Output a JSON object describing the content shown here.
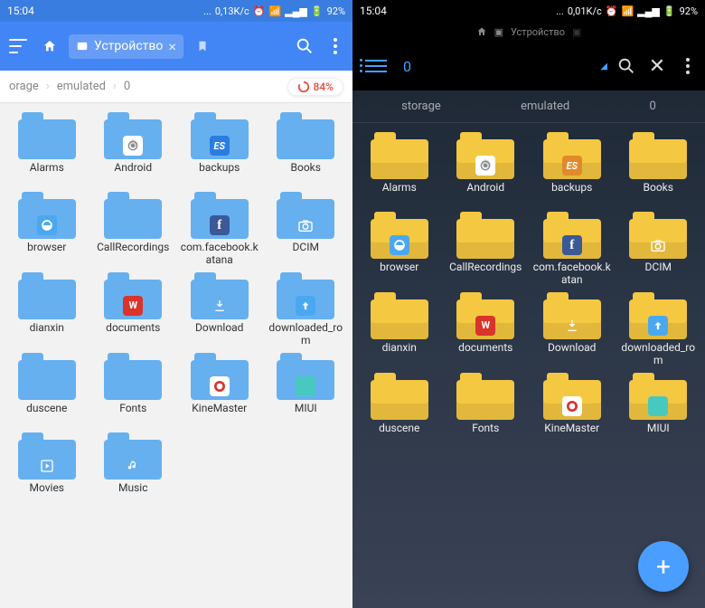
{
  "left": {
    "status": {
      "time": "15:04",
      "net_speed": "0,13K/c",
      "battery": "92%"
    },
    "toolbar": {
      "tab_label": "Устройство"
    },
    "breadcrumb": {
      "p1": "orage",
      "p2": "emulated",
      "p3": "0",
      "storage_pct": "84%"
    },
    "folders": [
      {
        "name": "Alarms"
      },
      {
        "name": "Android",
        "badge": "gear",
        "color": "#fff"
      },
      {
        "name": "backups",
        "badge": "es",
        "color": "#2a7de0"
      },
      {
        "name": "Books"
      },
      {
        "name": "browser",
        "badge": "leaf",
        "color": "#4aa8f0"
      },
      {
        "name": "CallRecordings"
      },
      {
        "name": "com.facebook.katana",
        "badge": "fb",
        "color": "#3b5998"
      },
      {
        "name": "DCIM",
        "badge": "cam",
        "color": "transparent"
      },
      {
        "name": "dianxin"
      },
      {
        "name": "documents",
        "badge": "wps",
        "color": "#d9332b"
      },
      {
        "name": "Download",
        "badge": "dl",
        "color": "transparent"
      },
      {
        "name": "downloaded_rom",
        "badge": "up",
        "color": "#4aa8f0"
      },
      {
        "name": "duscene"
      },
      {
        "name": "Fonts"
      },
      {
        "name": "KineMaster",
        "badge": "km",
        "color": "#fff"
      },
      {
        "name": "MIUI",
        "badge": "miui",
        "color": "#48c9c0"
      },
      {
        "name": "Movies",
        "badge": "play",
        "color": "transparent"
      },
      {
        "name": "Music",
        "badge": "music",
        "color": "transparent"
      },
      {
        "name": "",
        "hidden": true
      },
      {
        "name": "",
        "hidden": true
      }
    ]
  },
  "right": {
    "status": {
      "time": "15:04",
      "net_speed": "0,01K/c",
      "battery": "92%"
    },
    "mini_header": "Устройство",
    "toolbar": {
      "count": "0"
    },
    "breadcrumb": {
      "p1": "storage",
      "p2": "emulated",
      "p3": "0"
    },
    "folders": [
      {
        "name": "Alarms"
      },
      {
        "name": "Android",
        "badge": "gear",
        "color": "#fff"
      },
      {
        "name": "backups",
        "badge": "es",
        "color": "#e08a2a"
      },
      {
        "name": "Books"
      },
      {
        "name": "browser",
        "badge": "leaf",
        "color": "#4aa8f0"
      },
      {
        "name": "CallRecordings"
      },
      {
        "name": "com.facebook.katan",
        "badge": "fb",
        "color": "#3b5998"
      },
      {
        "name": "DCIM",
        "badge": "cam",
        "color": "transparent"
      },
      {
        "name": "dianxin"
      },
      {
        "name": "documents",
        "badge": "wps",
        "color": "#d9332b"
      },
      {
        "name": "Download",
        "badge": "dl",
        "color": "transparent"
      },
      {
        "name": "downloaded_rom",
        "badge": "up",
        "color": "#4aa8f0"
      },
      {
        "name": "duscene"
      },
      {
        "name": "Fonts"
      },
      {
        "name": "KineMaster",
        "badge": "km",
        "color": "#fff"
      },
      {
        "name": "MIUI",
        "badge": "miui",
        "color": "#48c9c0"
      }
    ]
  }
}
